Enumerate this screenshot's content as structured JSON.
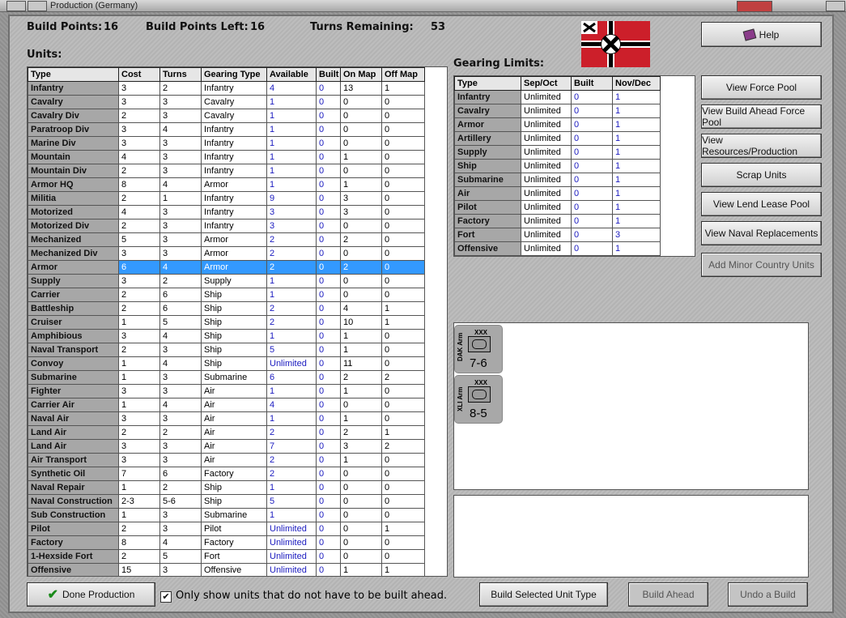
{
  "window": {
    "title": "Production (Germany)"
  },
  "stats": {
    "build_points_label": "Build Points:",
    "build_points": "16",
    "left_label": "Build Points Left:",
    "left": "16",
    "turns_label": "Turns Remaining:",
    "turns": "53"
  },
  "units_label": "Units:",
  "gearing_label": "Gearing Limits:",
  "units_table": {
    "headers": [
      "Type",
      "Cost",
      "Turns",
      "Gearing Type",
      "Available",
      "Built",
      "On Map",
      "Off Map"
    ],
    "rows": [
      [
        "Infantry",
        "3",
        "2",
        "Infantry",
        "4",
        "0",
        "13",
        "1"
      ],
      [
        "Cavalry",
        "3",
        "3",
        "Cavalry",
        "1",
        "0",
        "0",
        "0"
      ],
      [
        "Cavalry Div",
        "2",
        "3",
        "Cavalry",
        "1",
        "0",
        "0",
        "0"
      ],
      [
        "Paratroop Div",
        "3",
        "4",
        "Infantry",
        "1",
        "0",
        "0",
        "0"
      ],
      [
        "Marine Div",
        "3",
        "3",
        "Infantry",
        "1",
        "0",
        "0",
        "0"
      ],
      [
        "Mountain",
        "4",
        "3",
        "Infantry",
        "1",
        "0",
        "1",
        "0"
      ],
      [
        "Mountain Div",
        "2",
        "3",
        "Infantry",
        "1",
        "0",
        "0",
        "0"
      ],
      [
        "Armor HQ",
        "8",
        "4",
        "Armor",
        "1",
        "0",
        "1",
        "0"
      ],
      [
        "Militia",
        "2",
        "1",
        "Infantry",
        "9",
        "0",
        "3",
        "0"
      ],
      [
        "Motorized",
        "4",
        "3",
        "Infantry",
        "3",
        "0",
        "3",
        "0"
      ],
      [
        "Motorized Div",
        "2",
        "3",
        "Infantry",
        "3",
        "0",
        "0",
        "0"
      ],
      [
        "Mechanized",
        "5",
        "3",
        "Armor",
        "2",
        "0",
        "2",
        "0"
      ],
      [
        "Mechanized Div",
        "3",
        "3",
        "Armor",
        "2",
        "0",
        "0",
        "0"
      ],
      [
        "Armor",
        "6",
        "4",
        "Armor",
        "2",
        "0",
        "2",
        "0"
      ],
      [
        "Supply",
        "3",
        "2",
        "Supply",
        "1",
        "0",
        "0",
        "0"
      ],
      [
        "Carrier",
        "2",
        "6",
        "Ship",
        "1",
        "0",
        "0",
        "0"
      ],
      [
        "Battleship",
        "2",
        "6",
        "Ship",
        "2",
        "0",
        "4",
        "1"
      ],
      [
        "Cruiser",
        "1",
        "5",
        "Ship",
        "2",
        "0",
        "10",
        "1"
      ],
      [
        "Amphibious",
        "3",
        "4",
        "Ship",
        "1",
        "0",
        "1",
        "0"
      ],
      [
        "Naval Transport",
        "2",
        "3",
        "Ship",
        "5",
        "0",
        "1",
        "0"
      ],
      [
        "Convoy",
        "1",
        "4",
        "Ship",
        "Unlimited",
        "0",
        "11",
        "0"
      ],
      [
        "Submarine",
        "1",
        "3",
        "Submarine",
        "6",
        "0",
        "2",
        "2"
      ],
      [
        "Fighter",
        "3",
        "3",
        "Air",
        "1",
        "0",
        "1",
        "0"
      ],
      [
        "Carrier Air",
        "1",
        "4",
        "Air",
        "4",
        "0",
        "0",
        "0"
      ],
      [
        "Naval Air",
        "3",
        "3",
        "Air",
        "1",
        "0",
        "1",
        "0"
      ],
      [
        "Land Air",
        "2",
        "2",
        "Air",
        "2",
        "0",
        "2",
        "1"
      ],
      [
        "Land Air",
        "3",
        "3",
        "Air",
        "7",
        "0",
        "3",
        "2"
      ],
      [
        "Air Transport",
        "3",
        "3",
        "Air",
        "2",
        "0",
        "1",
        "0"
      ],
      [
        "Synthetic Oil",
        "7",
        "6",
        "Factory",
        "2",
        "0",
        "0",
        "0"
      ],
      [
        "Naval Repair",
        "1",
        "2",
        "Ship",
        "1",
        "0",
        "0",
        "0"
      ],
      [
        "Naval Construction",
        "2-3",
        "5-6",
        "Ship",
        "5",
        "0",
        "0",
        "0"
      ],
      [
        "Sub Construction",
        "1",
        "3",
        "Submarine",
        "1",
        "0",
        "0",
        "0"
      ],
      [
        "Pilot",
        "2",
        "3",
        "Pilot",
        "Unlimited",
        "0",
        "0",
        "1"
      ],
      [
        "Factory",
        "8",
        "4",
        "Factory",
        "Unlimited",
        "0",
        "0",
        "0"
      ],
      [
        "1-Hexside Fort",
        "2",
        "5",
        "Fort",
        "Unlimited",
        "0",
        "0",
        "0"
      ],
      [
        "Offensive",
        "15",
        "3",
        "Offensive",
        "Unlimited",
        "0",
        "1",
        "1"
      ]
    ],
    "selected_index": 13
  },
  "gearing_table": {
    "headers": [
      "Type",
      "Sep/Oct",
      "Built",
      "Nov/Dec"
    ],
    "rows": [
      [
        "Infantry",
        "Unlimited",
        "0",
        "1"
      ],
      [
        "Cavalry",
        "Unlimited",
        "0",
        "1"
      ],
      [
        "Armor",
        "Unlimited",
        "0",
        "1"
      ],
      [
        "Artillery",
        "Unlimited",
        "0",
        "1"
      ],
      [
        "Supply",
        "Unlimited",
        "0",
        "1"
      ],
      [
        "Ship",
        "Unlimited",
        "0",
        "1"
      ],
      [
        "Submarine",
        "Unlimited",
        "0",
        "1"
      ],
      [
        "Air",
        "Unlimited",
        "0",
        "1"
      ],
      [
        "Pilot",
        "Unlimited",
        "0",
        "1"
      ],
      [
        "Factory",
        "Unlimited",
        "0",
        "1"
      ],
      [
        "Fort",
        "Unlimited",
        "0",
        "3"
      ],
      [
        "Offensive",
        "Unlimited",
        "0",
        "1"
      ]
    ]
  },
  "buttons": {
    "help": "Help",
    "view_force_pool": "View Force Pool",
    "view_build_ahead": "View Build Ahead Force Pool",
    "view_resources": "View Resources/Production",
    "scrap_units": "Scrap Units",
    "view_lend_lease": "View Lend Lease Pool",
    "view_naval_repl": "View Naval Replacements",
    "add_minor": "Add Minor Country Units",
    "done": "Done Production",
    "build_selected": "Build Selected Unit Type",
    "build_ahead": "Build Ahead",
    "undo_build": "Undo a Build"
  },
  "checkbox": {
    "label": "Only show units that do not have to be built ahead.",
    "checked": "✔"
  },
  "counters": [
    {
      "name": "DAK Arm",
      "size": "XXX",
      "strength": "7-6"
    },
    {
      "name": "XLI Arm",
      "size": "XXX",
      "strength": "8-5"
    }
  ],
  "colors": {
    "selection": "#3399ff",
    "link_blue": "#1a1abf",
    "flag_red": "#cc1f2a"
  },
  "icons": {
    "help": "book-icon",
    "done": "checkmark-icon"
  }
}
